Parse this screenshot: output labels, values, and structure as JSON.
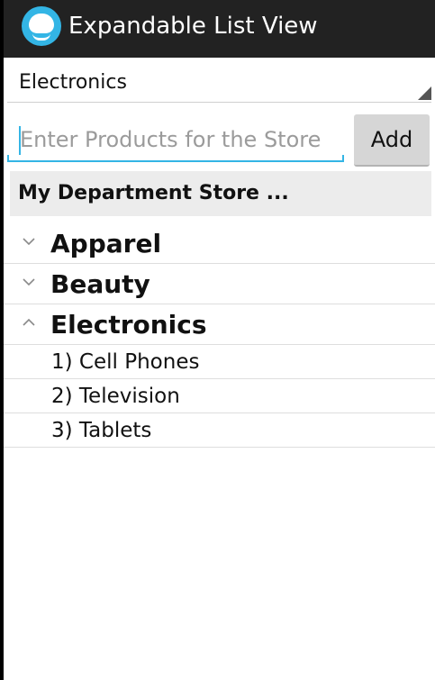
{
  "app": {
    "title": "Expandable List View",
    "icon": "smiley-app-icon"
  },
  "spinner": {
    "selected": "Electronics"
  },
  "product_input": {
    "value": "",
    "placeholder": "Enter Products for the Store"
  },
  "add_button": {
    "label": "Add"
  },
  "store_header": {
    "text": "My Department Store ..."
  },
  "groups": [
    {
      "label": "Apparel",
      "expanded": false,
      "children": []
    },
    {
      "label": "Beauty",
      "expanded": false,
      "children": []
    },
    {
      "label": "Electronics",
      "expanded": true,
      "children": [
        "1) Cell Phones",
        "2) Television",
        "3) Tablets"
      ]
    }
  ],
  "colors": {
    "accent": "#33b5e5",
    "actionbar": "#222222",
    "header_bg": "#ececec"
  }
}
